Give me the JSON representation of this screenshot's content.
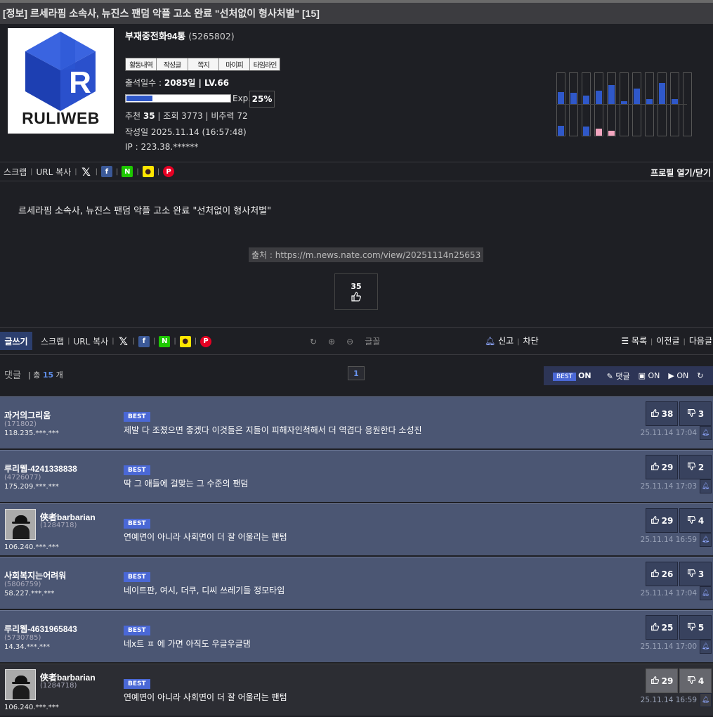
{
  "post": {
    "title": "[정보] 르세라핌 소속사, 뉴진스 팬덤 악플 고소 완료 \"선처없이 형사처벌\" [15]"
  },
  "profile": {
    "logo_text": "RULIWEB",
    "nickname": "부재중전화94통",
    "user_id": "(5265802)",
    "buttons": [
      "활동내역",
      "작성글",
      "쪽지",
      "마이피",
      "타임라인"
    ],
    "attendance_label": "출석일수 : ",
    "attendance_value": "2085일 | LV.66",
    "exp_label": "Exp.",
    "exp_percent": "25%",
    "exp_fraction": 0.25,
    "recommend_label": "추천 ",
    "recommend_value": "35",
    "stats_rest": " | 조회 3773 | 비추력 72",
    "date": "작성일 2025.11.14 (16:57:48)",
    "ip": "IP : 223.38.******",
    "activity_graph": {
      "up": [
        0.4,
        0.38,
        0.28,
        0.45,
        0.62,
        0.1,
        0.5,
        0.18,
        0.7,
        0.18,
        0
      ],
      "down": [
        0.3,
        0,
        0.28,
        0.22,
        0.15,
        0,
        0,
        0,
        0,
        0,
        0
      ],
      "down_pink": [
        false,
        false,
        false,
        true,
        true,
        false,
        false,
        false,
        false,
        false,
        false
      ],
      "colors": {
        "up": "#2f58c9",
        "down": "#2f58c9",
        "pink": "#f4a6c0"
      }
    }
  },
  "share": {
    "scrap": "스크랩",
    "url_copy": "URL 복사",
    "profile_toggle": "프로필 열기/닫기"
  },
  "article": {
    "body_title": "르세라핌 소속사, 뉴진스 팬덤 악플 고소 완료 \"선처없이 형사처벌\"",
    "source": "출처 : https://m.news.nate.com/view/20251114n25653",
    "likes": "35"
  },
  "toolbar": {
    "write": "글쓰기",
    "scrap": "스크랩",
    "url_copy": "URL 복사",
    "font": "글꼴",
    "report": "신고",
    "block": "차단",
    "list": "목록",
    "prev": "이전글",
    "next": "다음글"
  },
  "comments_header": {
    "label": "댓글",
    "total_prefix": "| 총 ",
    "total": "15",
    "total_suffix": " 개",
    "page": "1",
    "best": "BEST",
    "best_state": "ON",
    "reply": "댓글",
    "image_state": "ON",
    "video_state": "ON"
  },
  "comments": [
    {
      "name": "과거의그리움",
      "id": "(171802)",
      "ip": "118.235.***.***",
      "badge": "BEST",
      "text": "제발 다 조졌으면 좋겠다 이것들은 지들이 피해자인척해서 더 역겹다 응원한다 소성진",
      "up": "38",
      "down": "3",
      "date": "25.11.14 17:04",
      "avatar": false
    },
    {
      "name": "루리웹-4241338838",
      "id": "(4726077)",
      "ip": "175.209.***.***",
      "badge": "BEST",
      "text": "딱 그 애들에 걸맞는 그 수준의 팬덤",
      "up": "29",
      "down": "2",
      "date": "25.11.14 17:03",
      "avatar": false
    },
    {
      "name": "俠者barbarian",
      "id": "(1284718)",
      "ip": "106.240.***.***",
      "badge": "BEST",
      "text": "연예면이 아니라 사회면이 더 잘 어울리는 팬텀",
      "up": "29",
      "down": "4",
      "date": "25.11.14 16:59",
      "avatar": true
    },
    {
      "name": "사회복지는어려워",
      "id": "(5806759)",
      "ip": "58.227.***.***",
      "badge": "BEST",
      "text": "네이트판, 여시, 더쿠, 디씨 쓰레기들 정모타임",
      "up": "26",
      "down": "3",
      "date": "25.11.14 17:04",
      "avatar": false
    },
    {
      "name": "루리웹-4631965843",
      "id": "(5730785)",
      "ip": "14.34.***.***",
      "badge": "BEST",
      "text": "네x트 ㅍ 에 가면 아직도 우글우글댐",
      "up": "25",
      "down": "5",
      "date": "25.11.14 17:00",
      "avatar": false
    },
    {
      "name": "俠者barbarian",
      "id": "(1284718)",
      "ip": "106.240.***.***",
      "badge": "BEST",
      "text": "연예면이 아니라 사회면이 더 잘 어울리는 팬텀",
      "up": "29",
      "down": "4",
      "date": "25.11.14 16:59",
      "avatar": true
    }
  ]
}
